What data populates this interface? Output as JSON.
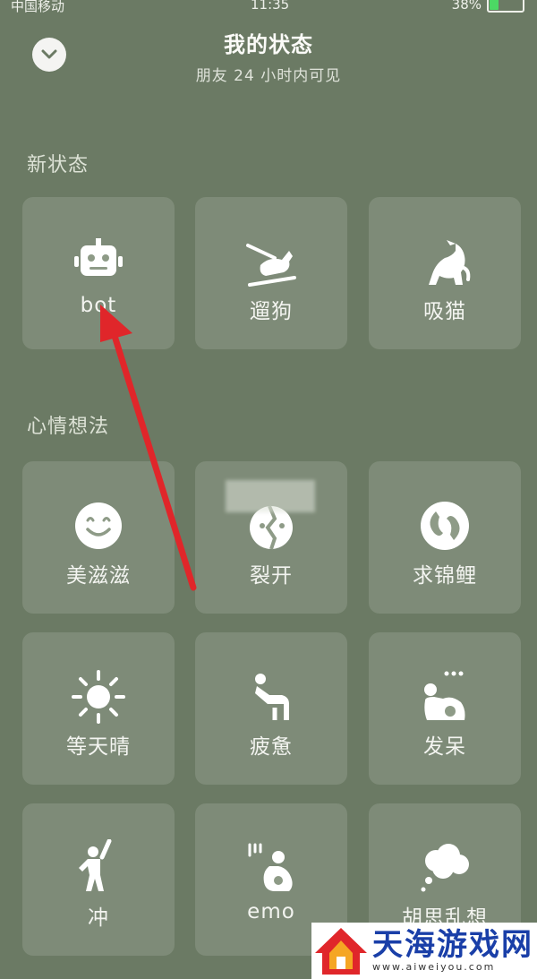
{
  "status_bar": {
    "carrier": "中国移动",
    "time": "11:35",
    "battery": "38%"
  },
  "header": {
    "title": "我的状态",
    "subtitle": "朋友 24 小时内可见"
  },
  "sections": {
    "new_status": {
      "label": "新状态",
      "items": [
        {
          "label": "bot",
          "icon": "robot-icon"
        },
        {
          "label": "遛狗",
          "icon": "dog-walk-icon"
        },
        {
          "label": "吸猫",
          "icon": "cat-icon"
        }
      ]
    },
    "mood": {
      "label": "心情想法",
      "items": [
        {
          "label": "美滋滋",
          "icon": "smile-icon"
        },
        {
          "label": "裂开",
          "icon": "cracked-face-icon"
        },
        {
          "label": "求锦鲤",
          "icon": "koi-icon"
        },
        {
          "label": "等天晴",
          "icon": "sun-icon"
        },
        {
          "label": "疲惫",
          "icon": "tired-person-icon"
        },
        {
          "label": "发呆",
          "icon": "daze-person-icon"
        },
        {
          "label": "冲",
          "icon": "rush-person-icon"
        },
        {
          "label": "emo",
          "icon": "emo-person-icon"
        },
        {
          "label": "胡思乱想",
          "icon": "thought-cloud-icon"
        }
      ]
    }
  },
  "watermark": {
    "title": "天海游戏网",
    "url": "www.aiweiyou.com"
  },
  "colors": {
    "background": "#6b7a64",
    "arrow": "#e0262a"
  }
}
